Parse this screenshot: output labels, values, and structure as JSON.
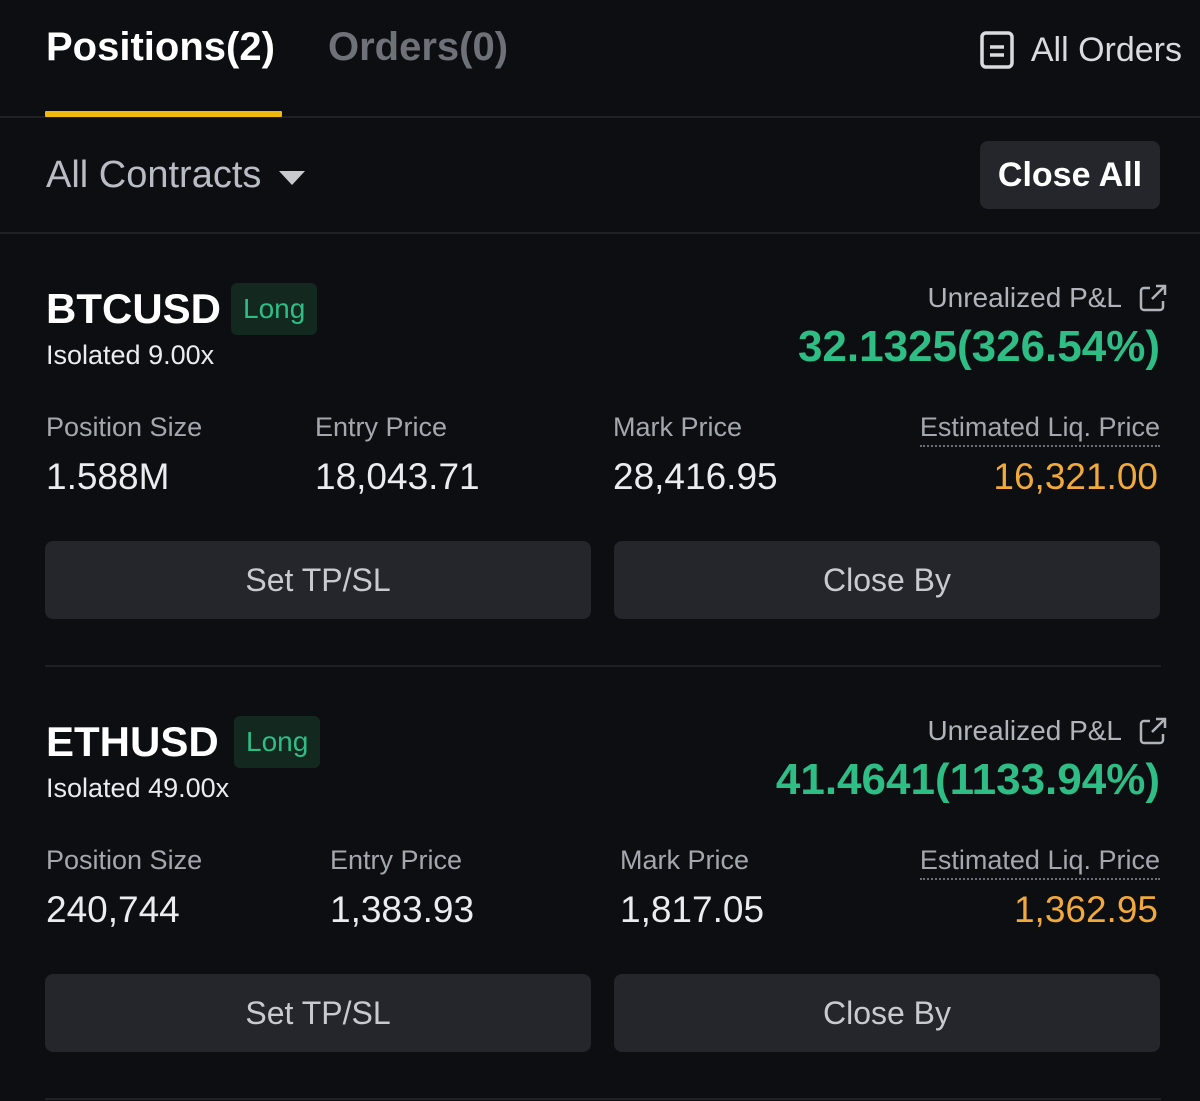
{
  "tabs": {
    "positions_label": "Positions(2)",
    "orders_label": "Orders(0)",
    "all_orders_label": "All Orders"
  },
  "filter": {
    "contracts_label": "All Contracts",
    "close_all_label": "Close All"
  },
  "colors": {
    "accent": "#f0b90b",
    "profit": "#2ebd85",
    "liquidation": "#f0a93a",
    "background": "#0d0e11",
    "button": "#24262c"
  },
  "positions": [
    {
      "symbol": "BTCUSD",
      "side": "Long",
      "margin_mode": "Isolated 9.00x",
      "pnl_label": "Unrealized P&L",
      "pnl_value": "32.1325(326.54%)",
      "size_label": "Position Size",
      "size_value": "1.588M",
      "entry_label": "Entry Price",
      "entry_value": "18,043.71",
      "mark_label": "Mark Price",
      "mark_value": "28,416.95",
      "liq_label": "Estimated Liq. Price",
      "liq_value": "16,321.00",
      "tpsl_label": "Set TP/SL",
      "close_by_label": "Close By"
    },
    {
      "symbol": "ETHUSD",
      "side": "Long",
      "margin_mode": "Isolated 49.00x",
      "pnl_label": "Unrealized P&L",
      "pnl_value": "41.4641(1133.94%)",
      "size_label": "Position Size",
      "size_value": "240,744",
      "entry_label": "Entry Price",
      "entry_value": "1,383.93",
      "mark_label": "Mark Price",
      "mark_value": "1,817.05",
      "liq_label": "Estimated Liq. Price",
      "liq_value": "1,362.95",
      "tpsl_label": "Set TP/SL",
      "close_by_label": "Close By"
    }
  ]
}
